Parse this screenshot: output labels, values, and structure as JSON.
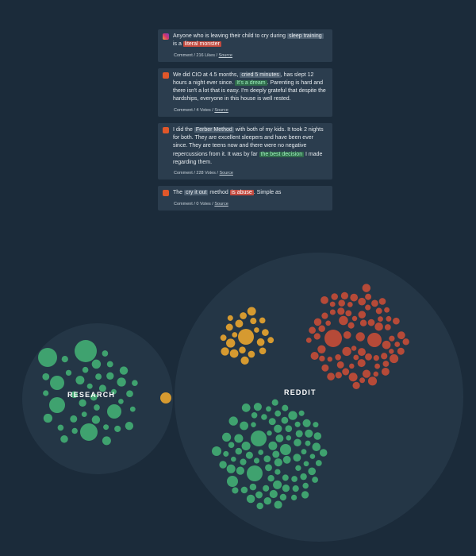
{
  "comments": [
    {
      "source_icon": "instagram-icon",
      "segments": [
        {
          "text": "Anyone who is leaving their child to cry during ",
          "hl": ""
        },
        {
          "text": "sleep training",
          "hl": "neutral"
        },
        {
          "text": " is a ",
          "hl": ""
        },
        {
          "text": "literal monster",
          "hl": "negative"
        }
      ],
      "meta": {
        "type": "Comment",
        "stat": "216 Likes",
        "link": "Source"
      }
    },
    {
      "source_icon": "reddit-icon",
      "segments": [
        {
          "text": "We did CIO at 4.5 months, ",
          "hl": ""
        },
        {
          "text": "cried 5 minutes",
          "hl": "neutral"
        },
        {
          "text": ", has slept 12 hours a night ever since. ",
          "hl": ""
        },
        {
          "text": "It's a dream",
          "hl": "positive"
        },
        {
          "text": ". Parenting is hard and there isn't a lot that is easy. I'm deeply grateful that despite the hardships, everyone in this house is well rested.",
          "hl": ""
        }
      ],
      "meta": {
        "type": "Comment",
        "stat": "4 Votes",
        "link": "Source"
      }
    },
    {
      "source_icon": "reddit-icon",
      "segments": [
        {
          "text": "I did the ",
          "hl": ""
        },
        {
          "text": "Ferber Method",
          "hl": "neutral"
        },
        {
          "text": " with both of my kids. It took 2 nights for both. They are excellent sleepers and have been ever since. They are teens now and there were no negative repercussions from it. It was by far ",
          "hl": ""
        },
        {
          "text": "the best decision",
          "hl": "positive"
        },
        {
          "text": " I made regarding them.",
          "hl": ""
        }
      ],
      "meta": {
        "type": "Comment",
        "stat": "228 Votes",
        "link": "Source"
      }
    },
    {
      "source_icon": "reddit-icon",
      "segments": [
        {
          "text": "The ",
          "hl": ""
        },
        {
          "text": "cry it out",
          "hl": "neutral"
        },
        {
          "text": " method ",
          "hl": ""
        },
        {
          "text": "is abuse",
          "hl": "negative"
        },
        {
          "text": ". Simple as",
          "hl": ""
        }
      ],
      "meta": {
        "type": "Comment",
        "stat": "0 Votes",
        "link": "Source"
      }
    }
  ],
  "groups": [
    {
      "label": "RESEARCH",
      "clusters": [
        {
          "sentiment": "positive",
          "count": 75
        }
      ]
    },
    {
      "label": "REDDIT",
      "clusters": [
        {
          "sentiment": "neutral",
          "count": 40
        },
        {
          "sentiment": "negative",
          "count": 150
        },
        {
          "sentiment": "positive",
          "count": 165
        }
      ]
    }
  ],
  "colors": {
    "background": "#1b2b3a",
    "group_halo": "#243646",
    "positive": "#3fa26f",
    "neutral": "#d69a30",
    "negative": "#b64a38",
    "card_bg": "#2b3d4e"
  }
}
